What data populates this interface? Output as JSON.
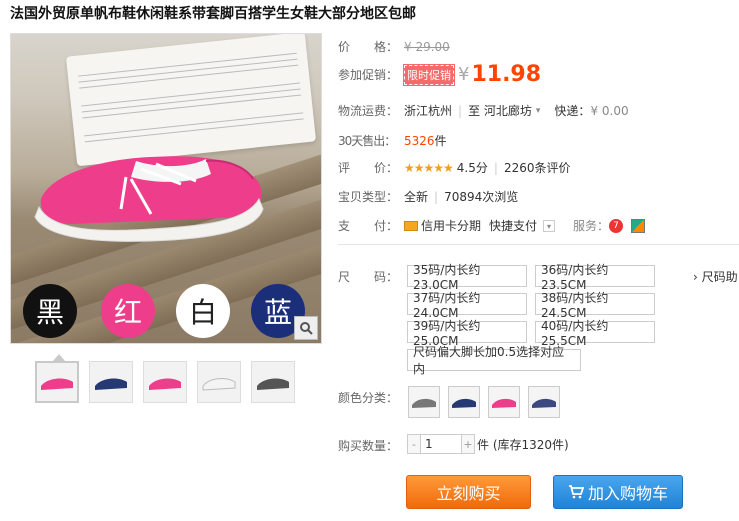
{
  "title": "法国外贸原单帆布鞋休闲鞋系带套脚百搭学生女鞋大部分地区包邮",
  "gallery": {
    "swatch_labels": [
      "黑",
      "红",
      "白",
      "蓝"
    ],
    "zoom_icon": "magnifier-icon",
    "thumbnails": [
      "pink-multi",
      "navy",
      "pink",
      "white",
      "gray"
    ]
  },
  "price": {
    "label": "价　　格：",
    "original": "¥ 29.00"
  },
  "promo": {
    "label": "参加促销：",
    "badge": "限时促销",
    "currency": "¥",
    "price": "11.98"
  },
  "shipping": {
    "label": "物流运费：",
    "from": "浙江杭州",
    "to": "至  河北廊坊",
    "type": "快递：",
    "fee": "¥ 0.00"
  },
  "sold": {
    "label": "30天售出：",
    "count": "5326",
    "unit": "件"
  },
  "rating": {
    "label": "评　　价：",
    "stars": "★★★★★",
    "score": "4.5分",
    "reviews": "2260条评价"
  },
  "item_type": {
    "label": "宝贝类型：",
    "condition": "全新",
    "views": "70894次浏览"
  },
  "payment": {
    "label": "支　　付：",
    "installment": "信用卡分期",
    "quickpay": "快捷支付",
    "service_label": "服务："
  },
  "sizes": {
    "label": "尺　　码：",
    "options": [
      "35码/内长约23.0CM",
      "36码/内长约23.5CM",
      "37码/内长约24.0CM",
      "38码/内长约24.5CM",
      "39码/内长约25.0CM",
      "40码/内长约25.5CM",
      "尺码偏大脚长加0.5选择对应内"
    ],
    "help": "› 尺码助"
  },
  "colors": {
    "label": "颜色分类：",
    "options": [
      "gray",
      "navy",
      "pink",
      "navy-2"
    ]
  },
  "quantity": {
    "label": "购买数量：",
    "value": "1",
    "stock": "件 (库存1320件)",
    "minus": "-",
    "plus": "+"
  },
  "actions": {
    "buy": "立刻购买",
    "cart": "加入购物车"
  },
  "colors_hex": {
    "accent": "#ff4400",
    "buy": "#f06a0a",
    "cart": "#1f83d6"
  }
}
